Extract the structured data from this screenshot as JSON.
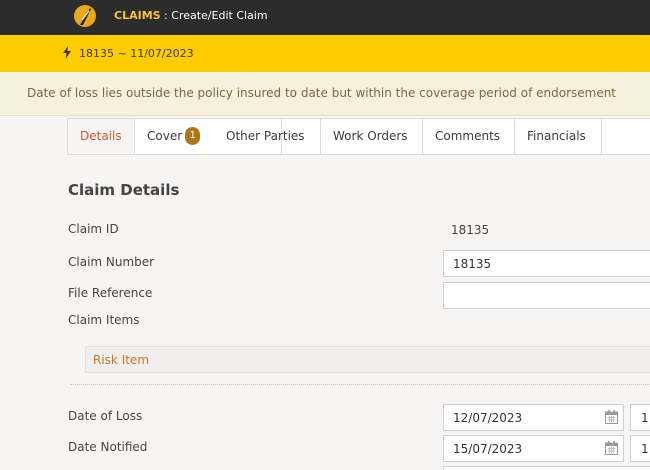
{
  "header": {
    "module": "CLAIMS",
    "page_title": " : Create/Edit Claim"
  },
  "context_bar": {
    "claim_ref": "18135 ~ 11/07/2023"
  },
  "warning": {
    "message": "Date of loss lies outside the policy insured to date but within the coverage period of endorsement"
  },
  "tabs": [
    {
      "label": "Details",
      "active": true
    },
    {
      "label": "Cover",
      "badge": "1"
    },
    {
      "label": "Other Parties"
    },
    {
      "label": "Work Orders"
    },
    {
      "label": "Comments"
    },
    {
      "label": "Financials"
    }
  ],
  "form": {
    "section_title": "Claim Details",
    "claim_id_label": "Claim ID",
    "claim_id_value": "18135",
    "claim_number_label": "Claim Number",
    "claim_number_value": "18135",
    "file_reference_label": "File Reference",
    "file_reference_value": "",
    "claim_items_label": "Claim Items",
    "risk_item_label": "Risk Item",
    "date_of_loss_label": "Date of Loss",
    "date_of_loss_value": "12/07/2023",
    "date_of_loss_time": "1",
    "date_notified_label": "Date Notified",
    "date_notified_value": "15/07/2023",
    "date_notified_time": "1"
  },
  "colors": {
    "topbar": "#2c2c2c",
    "context_bar": "#ffcc00",
    "warning_bg": "#f6f1dd",
    "active_tab_text": "#d05a2e",
    "badge": "#b0741b",
    "risk_item_text": "#c27a2a"
  },
  "icons": {
    "logo": "feather-logo",
    "context": "lightning-icon",
    "date_picker": "calendar-icon"
  }
}
